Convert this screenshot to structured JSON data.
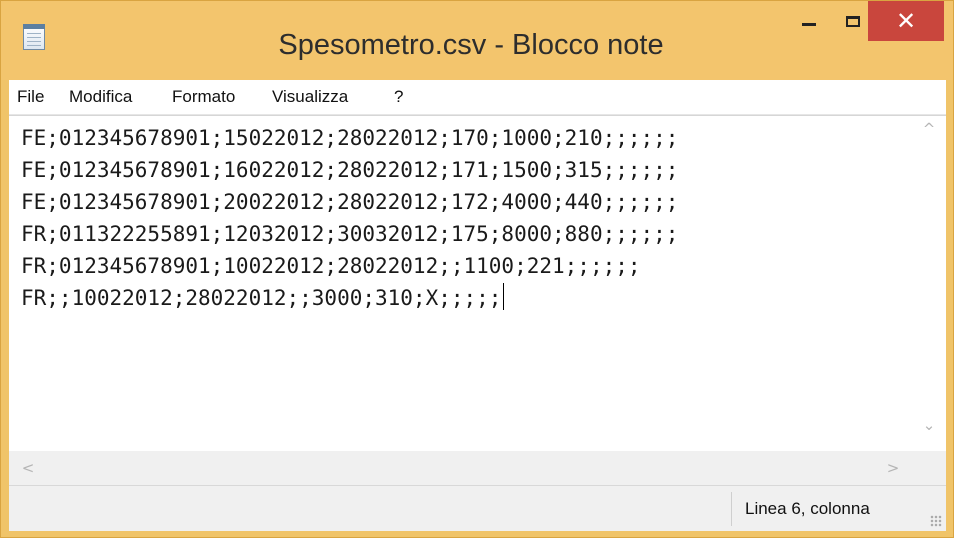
{
  "window": {
    "title": "Spesometro.csv - Blocco note",
    "close_glyph": "✕"
  },
  "menu": {
    "items": [
      "File",
      "Modifica",
      "Formato",
      "Visualizza",
      "?"
    ]
  },
  "editor": {
    "lines": [
      "FE;012345678901;15022012;28022012;170;1000;210;;;;;;",
      "FE;012345678901;16022012;28022012;171;1500;315;;;;;;",
      "FE;012345678901;20022012;28022012;172;4000;440;;;;;;",
      "FR;011322255891;12032012;30032012;175;8000;880;;;;;;",
      "FR;012345678901;10022012;28022012;;1100;221;;;;;;",
      "FR;;10022012;28022012;;3000;310;X;;;;;"
    ]
  },
  "scrollbars": {
    "up_arrow": "^",
    "down_arrow": "⌄",
    "left_arrow": "<",
    "right_arrow": ">"
  },
  "status": {
    "position": "Linea 6, colonna"
  }
}
